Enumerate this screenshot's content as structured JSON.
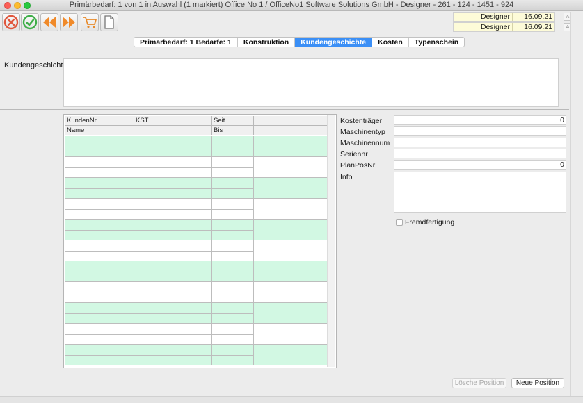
{
  "window": {
    "title": "Primärbedarf: 1 von 1 in Auswahl  (1 markiert) Office No 1 /  OfficeNo1 Software Solutions GmbH - Designer - 261 - 124 - 1451 - 924"
  },
  "toolbar": {
    "buttons": [
      "cancel",
      "confirm",
      "previous",
      "next",
      "cart",
      "document"
    ]
  },
  "info": [
    {
      "user": "Designer",
      "date": "16.09.21"
    },
    {
      "user": "Designer",
      "date": "16.09.21"
    }
  ],
  "tabs": [
    {
      "label": "Primärbedarf: 1 Bedarfe: 1",
      "active": false
    },
    {
      "label": "Konstruktion",
      "active": false
    },
    {
      "label": "Kundengeschichte",
      "active": true
    },
    {
      "label": "Kosten",
      "active": false
    },
    {
      "label": "Typenschein",
      "active": false
    }
  ],
  "kundengeschicht": {
    "label": "Kundengeschicht",
    "value": ""
  },
  "grid": {
    "headers_row1": [
      "KundenNr",
      "KST",
      "Seit"
    ],
    "headers_row2": [
      "Name",
      "Bis"
    ]
  },
  "form": {
    "kostentraeger": {
      "label": "Kostenträger",
      "value": "0"
    },
    "maschinentyp": {
      "label": "Maschinentyp",
      "value": ""
    },
    "maschinennum": {
      "label": "Maschinennum",
      "value": ""
    },
    "seriennr": {
      "label": "Seriennr",
      "value": ""
    },
    "planposnr": {
      "label": "PlanPosNr",
      "value": "0"
    },
    "info": {
      "label": "Info",
      "value": ""
    },
    "fremdfertigung": {
      "label": "Fremdfertigung",
      "checked": false
    }
  },
  "buttons": {
    "loesche": "Lösche Position",
    "neue": "Neue Position"
  },
  "colors": {
    "accent": "#3b8ff6",
    "row_alt": "#d2f8e3",
    "info_bg": "#fdfbd8"
  }
}
